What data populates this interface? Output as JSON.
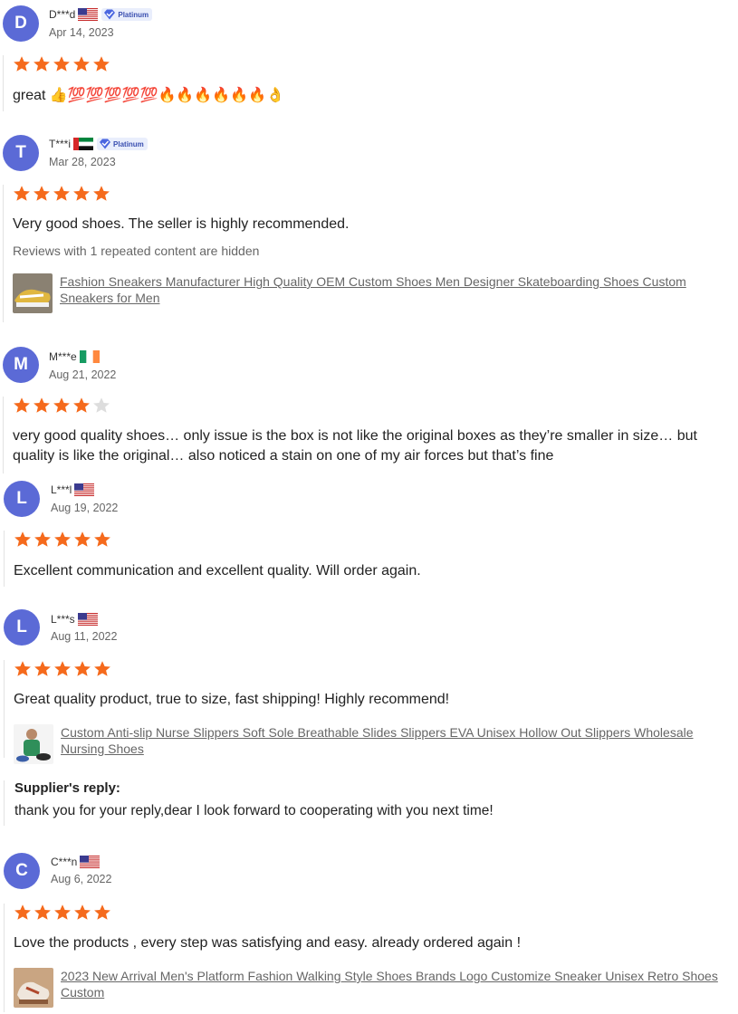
{
  "reviews": [
    {
      "initial": "D",
      "name": "D***d",
      "country": "us",
      "badge": "Platinum",
      "date": "Apr 14, 2023",
      "rating": 5,
      "text": "great 👍💯💯💯💯💯🔥🔥🔥🔥🔥🔥👌"
    },
    {
      "initial": "T",
      "name": "T***i",
      "country": "ae",
      "badge": "Platinum",
      "date": "Mar 28, 2023",
      "rating": 5,
      "text": "Very good shoes. The seller is highly recommended.",
      "hidden_note": "Reviews with 1 repeated content are hidden",
      "product": "Fashion Sneakers Manufacturer High Quality OEM Custom Shoes Men Designer Skateboarding Shoes Custom Sneakers for Men"
    },
    {
      "initial": "M",
      "name": "M***e",
      "country": "ie",
      "date": "Aug 21, 2022",
      "rating": 4,
      "text": "very good quality shoes… only issue is the box is not like the original boxes as they’re smaller in size… but quality is like the original… also noticed a stain on one of my air forces but that’s fine"
    },
    {
      "initial": "L",
      "name": "L***l",
      "country": "us",
      "date": "Aug 19, 2022",
      "rating": 5,
      "text": "Excellent communication and excellent quality. Will order again."
    },
    {
      "initial": "L",
      "name": "L***s",
      "country": "us",
      "date": "Aug 11, 2022",
      "rating": 5,
      "text": "Great quality product, true to size, fast shipping! Highly recommend!",
      "product": "Custom Anti-slip Nurse Slippers Soft Sole Breathable Slides Slippers EVA Unisex Hollow Out Slippers Wholesale Nursing Shoes",
      "reply_title": "Supplier's reply:",
      "reply_text": "thank you for your reply,dear I look forward to cooperating with you next time!"
    },
    {
      "initial": "C",
      "name": "C***n",
      "country": "us",
      "date": "Aug 6, 2022",
      "rating": 5,
      "text": "Love the products , every step was satisfying and easy. already ordered again !",
      "product": "2023 New Arrival Men's Platform Fashion Walking Style Shoes Brands Logo Customize Sneaker Unisex Retro Shoes Custom"
    }
  ],
  "colors": {
    "star": "#f56a1c",
    "star_empty": "#dddddd",
    "avatar": "#5b6ad6",
    "badge_text": "#3a4fb0"
  }
}
